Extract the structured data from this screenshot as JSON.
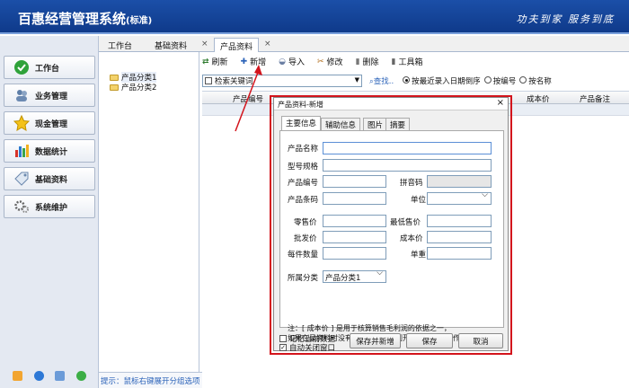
{
  "app": {
    "title": "百惠经营管理系统",
    "edition": "(标准)",
    "slogan": "功夫到家  服务到底"
  },
  "sidebar": {
    "items": [
      {
        "label": "工作台",
        "icon": "check-circle-icon"
      },
      {
        "label": "业务管理",
        "icon": "users-icon"
      },
      {
        "label": "现金管理",
        "icon": "star-icon"
      },
      {
        "label": "数据统计",
        "icon": "bar-chart-icon"
      },
      {
        "label": "基础资料",
        "icon": "tag-icon"
      },
      {
        "label": "系统维护",
        "icon": "gears-icon"
      }
    ],
    "bottom_icons": [
      "edit-icon",
      "info-icon",
      "window-icon",
      "power-icon"
    ]
  },
  "tabs": [
    {
      "label": "工作台"
    },
    {
      "label": "基础资料"
    },
    {
      "label": "产品资料"
    }
  ],
  "tree": {
    "items": [
      "产品分类1",
      "产品分类2"
    ]
  },
  "hint": "提示：鼠标右键展开分组选项",
  "toolbar": {
    "refresh": "刷新",
    "add": "新增",
    "import": "导入",
    "edit": "修改",
    "delete": "删除",
    "toolbox": "工具箱"
  },
  "filter": {
    "placeholder": "检索关键词",
    "search": "查找..",
    "sort_options": [
      "按最近录入日期倒序",
      "按编号",
      "按名称"
    ],
    "selected_sort": "按最近录入日期倒序"
  },
  "grid": {
    "headers": [
      "产品编号",
      "成本价",
      "产品备注"
    ]
  },
  "dialog": {
    "title": "产品资料-新增",
    "tabs": [
      "主要信息",
      "辅助信息",
      "图片",
      "摘要"
    ],
    "fields": {
      "name": "产品名称",
      "spec": "型号规格",
      "code": "产品编号",
      "pinyin": "拼音码",
      "barcode": "产品条码",
      "unit": "单位",
      "retail": "零售价",
      "min_price": "最低售价",
      "wholesale": "批发价",
      "cost": "成本价",
      "qty_per": "每件数量",
      "weight": "单重",
      "category": "所属分类"
    },
    "category_value": "产品分类1",
    "note": "注：[ 成本价 ] 是用于核算销售毛利润的依据之一，\n如果在录资料时没有填写成本价，则开单默认零售价作为成本价。",
    "remember": "记忆当前数据",
    "auto_close": "自动关闭窗口",
    "btn_save_new": "保存并新增",
    "btn_save": "保存",
    "btn_cancel": "取消"
  },
  "colors": {
    "titlebar": "#1b4fa8",
    "highlight": "#d3141c",
    "link": "#2a62b8"
  }
}
